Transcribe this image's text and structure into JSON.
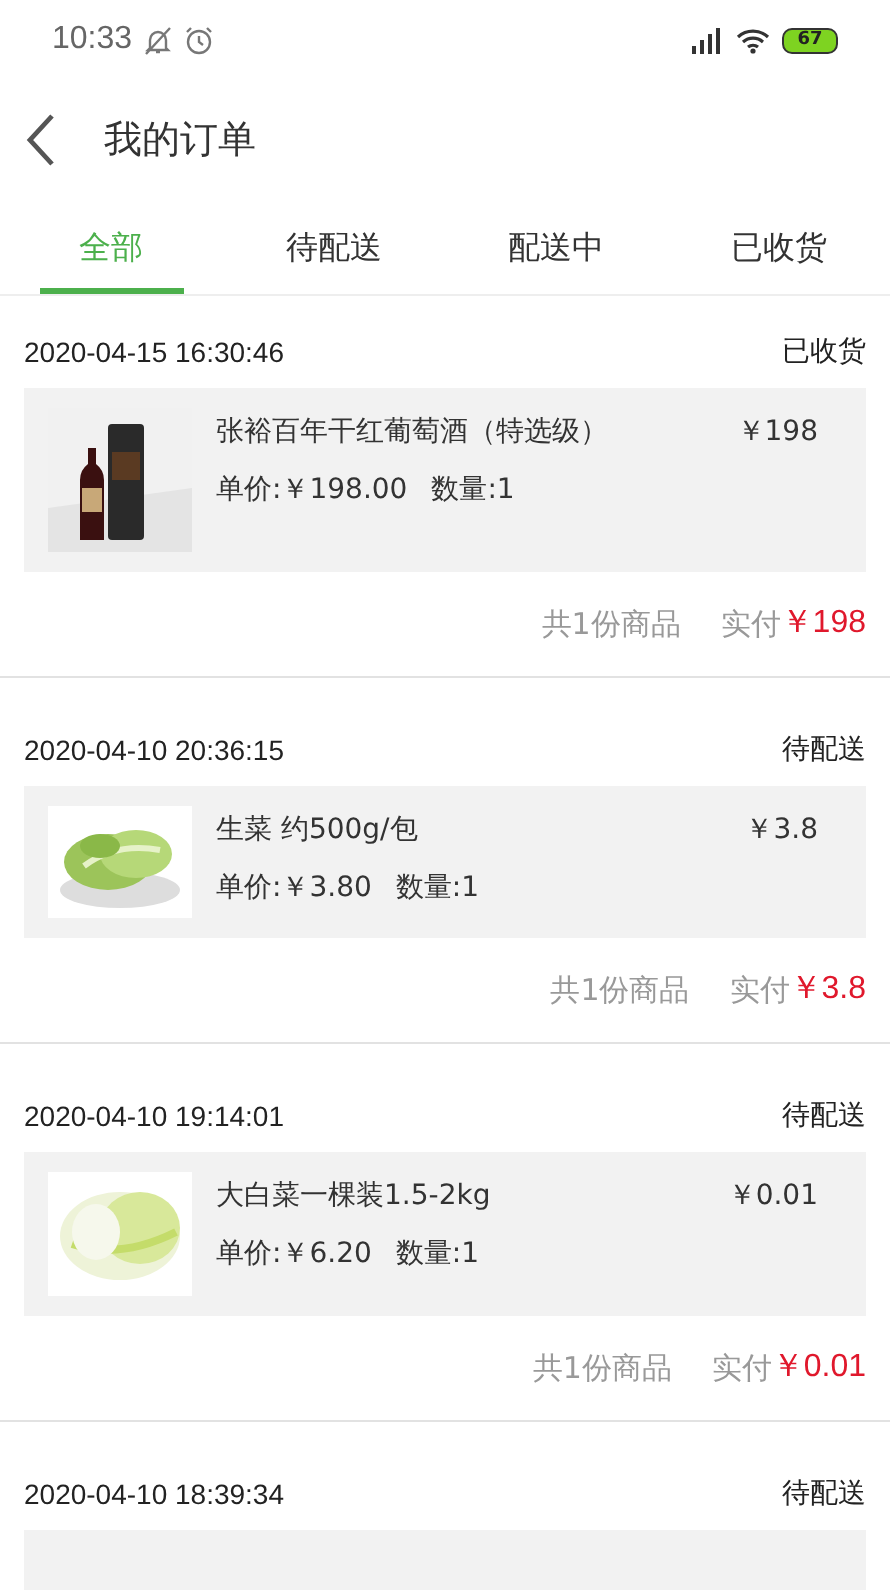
{
  "status_bar": {
    "time": "10:33",
    "battery": "67"
  },
  "header": {
    "title": "我的订单"
  },
  "tabs": [
    {
      "label": "全部",
      "selected": true
    },
    {
      "label": "待配送",
      "selected": false
    },
    {
      "label": "配送中",
      "selected": false
    },
    {
      "label": "已收货",
      "selected": false
    }
  ],
  "orders": [
    {
      "date": "2020-04-15 16:30:46",
      "status": "已收货",
      "items": [
        {
          "kind": "picture",
          "name": "张裕百年干红葡萄酒（特选级）",
          "unit_price": "单价:￥198.00",
          "quantity": "数量:1",
          "price": "￥198"
        }
      ],
      "count": "共1份商品",
      "paid_label": "实付",
      "paid": "￥198"
    },
    {
      "date": "2020-04-10 20:36:15",
      "status": "待配送",
      "items": [
        {
          "kind": "picture",
          "name": "生菜 约500g/包",
          "unit_price": "单价:￥3.80",
          "quantity": "数量:1",
          "price": "￥3.8"
        }
      ],
      "count": "共1份商品",
      "paid_label": "实付",
      "paid": "￥3.8"
    },
    {
      "date": "2020-04-10 19:14:01",
      "status": "待配送",
      "items": [
        {
          "kind": "picture",
          "name": "大白菜一棵装1.5-2kg",
          "unit_price": "单价:￥6.20",
          "quantity": "数量:1",
          "price": "￥0.01"
        }
      ],
      "count": "共1份商品",
      "paid_label": "实付",
      "paid": "￥0.01"
    },
    {
      "date": "2020-04-10 18:39:34",
      "status": "待配送"
    }
  ]
}
